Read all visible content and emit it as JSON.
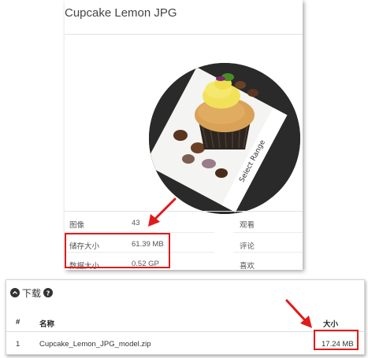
{
  "page": {
    "title": "Cupcake Lemon JPG"
  },
  "stats": [
    {
      "label": "图像",
      "value": "43"
    },
    {
      "label": "储存大小",
      "value": "61.39 MB"
    },
    {
      "label": "数据大小",
      "value": "0.52 GP"
    }
  ],
  "stats_right": [
    "观看",
    "评论",
    "喜欢"
  ],
  "downloads": {
    "title": "下载",
    "columns": [
      "#",
      "名称",
      "大小"
    ],
    "rows": [
      {
        "index": "1",
        "name": "Cupcake_Lemon_JPG_model.zip",
        "size": "17.24 MB"
      }
    ]
  },
  "image_text": "Select Range",
  "colors": {
    "annotation": "#e01b1b",
    "disc": "#2a2a2a",
    "frosting": "#f2e25a"
  },
  "icons": [
    "chevron-up-circle-icon",
    "question-circle-icon",
    "red-arrow"
  ]
}
